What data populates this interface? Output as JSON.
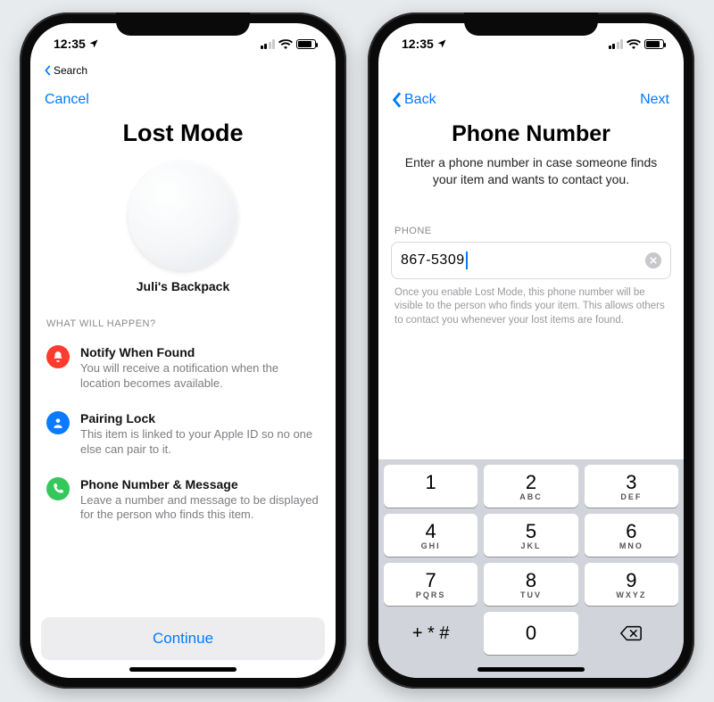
{
  "status": {
    "time": "12:35",
    "back_small": "Search"
  },
  "screen1": {
    "nav": {
      "cancel": "Cancel"
    },
    "title": "Lost Mode",
    "item_name": "Juli's Backpack",
    "section_label": "WHAT WILL HAPPEN?",
    "features": [
      {
        "title": "Notify When Found",
        "desc": "You will receive a notification when the location becomes available."
      },
      {
        "title": "Pairing Lock",
        "desc": "This item is linked to your Apple ID so no one else can pair to it."
      },
      {
        "title": "Phone Number & Message",
        "desc": "Leave a number and message to be displayed for the person who finds this item."
      }
    ],
    "continue": "Continue"
  },
  "screen2": {
    "nav": {
      "back": "Back",
      "next": "Next"
    },
    "title": "Phone Number",
    "subtitle": "Enter a phone number in case someone finds your item and wants to contact you.",
    "phone_label": "PHONE",
    "phone_value": "867-5309",
    "helper": "Once you enable Lost Mode, this phone number will be visible to the person who finds your item. This allows others to contact you whenever your lost items are found.",
    "keys": [
      {
        "d": "1",
        "s": ""
      },
      {
        "d": "2",
        "s": "ABC"
      },
      {
        "d": "3",
        "s": "DEF"
      },
      {
        "d": "4",
        "s": "GHI"
      },
      {
        "d": "5",
        "s": "JKL"
      },
      {
        "d": "6",
        "s": "MNO"
      },
      {
        "d": "7",
        "s": "PQRS"
      },
      {
        "d": "8",
        "s": "TUV"
      },
      {
        "d": "9",
        "s": "WXYZ"
      }
    ],
    "symbol_key": "+ * #",
    "zero": "0"
  }
}
